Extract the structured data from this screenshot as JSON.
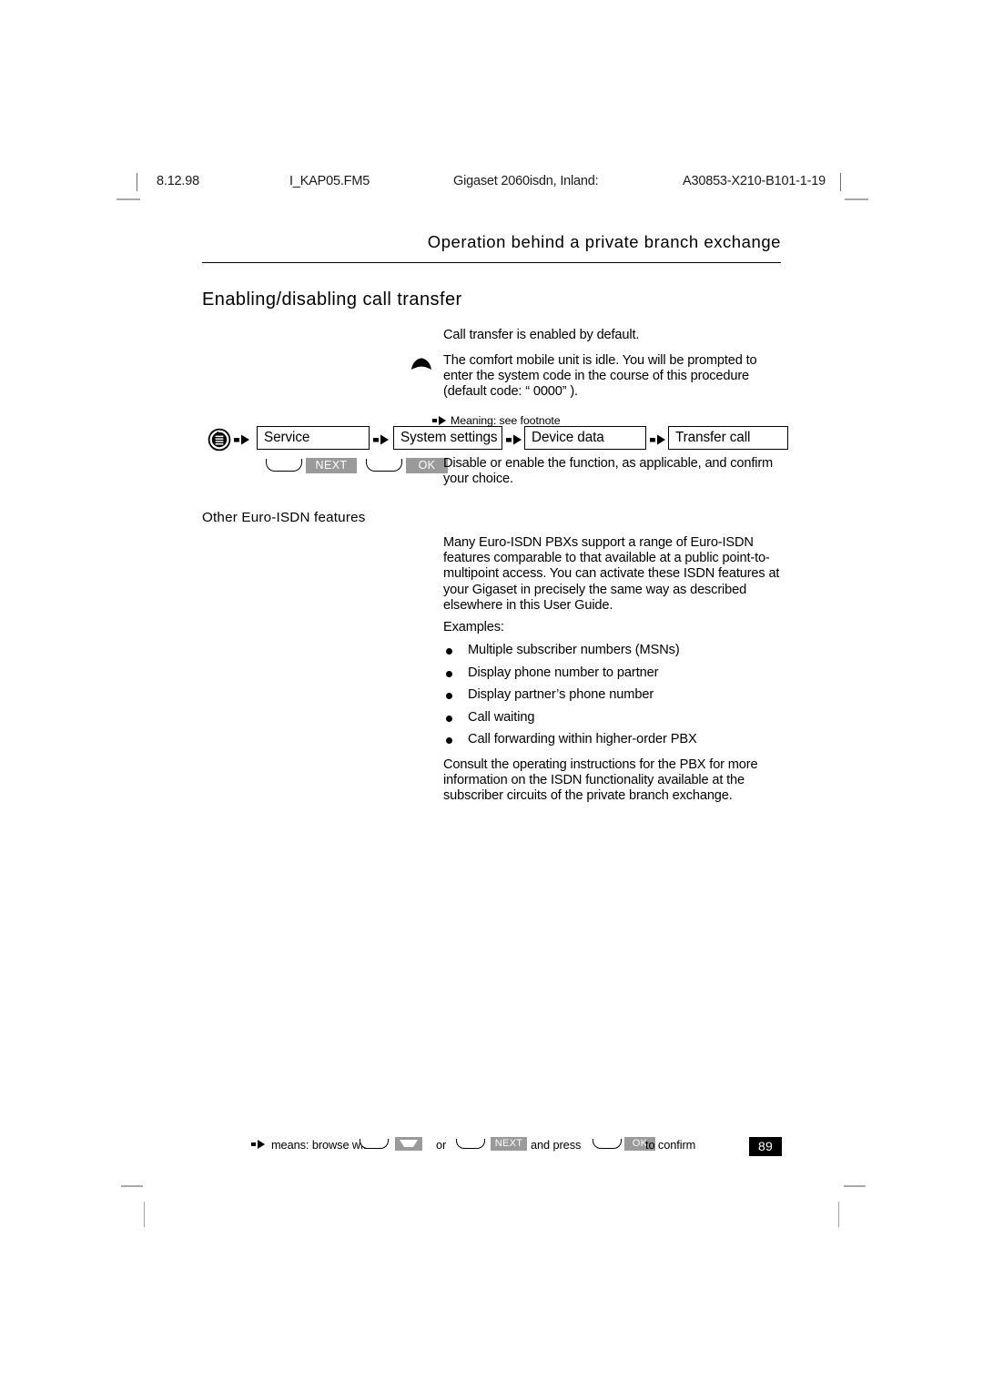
{
  "printer_marks": {
    "date": "8.12.98",
    "filename": "I_KAP05.FM5",
    "product": "Gigaset 2060isdn, Inland:",
    "doc_code": "A30853-X210-B101-1-19"
  },
  "header": {
    "chapter_title": "Operation behind a private branch exchange"
  },
  "section": {
    "title": "Enabling/disabling call transfer"
  },
  "body": {
    "intro": "Call transfer is enabled by default.",
    "handset_note": "The comfort mobile unit is idle. You will be prompted to enter the system code in the course of this procedure (default code: “ 0000” ).",
    "disable_note": "Disable or enable the function, as applicable, and confirm your choice.",
    "many_pbx": "Many Euro-ISDN PBXs support a range of Euro-ISDN features comparable to that available at a public point-to-multipoint access. You can activate these ISDN features at your Gigaset in precisely the same way as described elsewhere in this User Guide.",
    "examples_label": "Examples:",
    "consult": "Consult the operating instructions for the PBX for more information on the ISDN functionality available at the subscriber circuits of the private branch exchange."
  },
  "left_labels": {
    "other_features": "Other Euro-ISDN features"
  },
  "menu_flow": {
    "footnote_hint": "Meaning: see footnote",
    "steps": [
      {
        "label": "Service"
      },
      {
        "label": "System settings"
      },
      {
        "label": "Device data"
      },
      {
        "label": "Transfer call"
      }
    ],
    "soft_keys": [
      {
        "label": "NEXT"
      },
      {
        "label": "OK"
      }
    ]
  },
  "bullets": [
    "Multiple subscriber numbers (MSNs)",
    "Display phone number to partner",
    "Display partner’s phone number",
    "Call waiting",
    "Call forwarding within higher-order PBX"
  ],
  "footer": {
    "means": "means: browse with",
    "or": "or",
    "and_press": "and press",
    "to_confirm": "to confirm",
    "key_down": "",
    "key_next": "NEXT",
    "key_ok": "OK",
    "page_number": "89"
  },
  "colors": {
    "text": "#000000",
    "key_gray": "#9a9a9a",
    "crop_gray": "#a8a8a8",
    "page_bg": "#ffffff"
  }
}
